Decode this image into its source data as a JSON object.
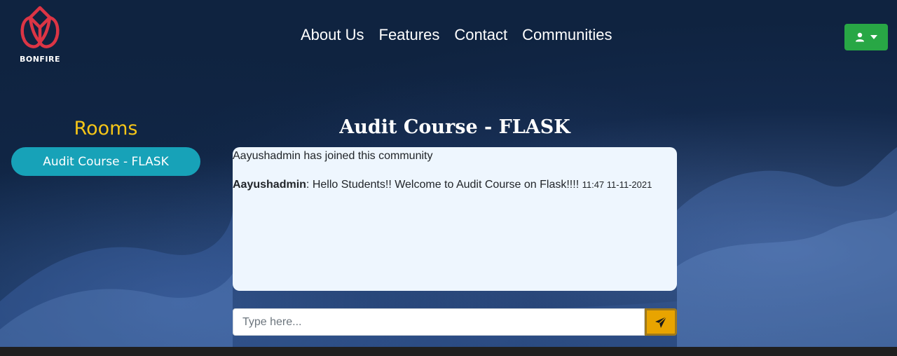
{
  "brand": {
    "name": "BONFIRE",
    "logo_color": "#dc3545"
  },
  "nav": {
    "items": [
      {
        "label": "About Us"
      },
      {
        "label": "Features"
      },
      {
        "label": "Contact"
      },
      {
        "label": "Communities"
      }
    ]
  },
  "user_menu": {
    "icon": "user-icon",
    "caret": "caret-down-icon",
    "color": "#28a745"
  },
  "sidebar": {
    "title": "Rooms",
    "title_color": "#f5c518",
    "rooms": [
      {
        "label": "Audit Course - FLASK",
        "color": "#17a2b8"
      }
    ]
  },
  "chat": {
    "title": "Audit Course - FLASK",
    "join_message": "Aayushadmin has joined this community",
    "messages": [
      {
        "user": "Aayushadmin",
        "text": ": Hello Students!! Welcome to Audit Course on Flask!!!! ",
        "time": "11:47 11-11-2021"
      }
    ],
    "input_placeholder": "Type here...",
    "input_value": "",
    "send_icon": "paper-plane-icon",
    "send_color": "#e8a400"
  }
}
